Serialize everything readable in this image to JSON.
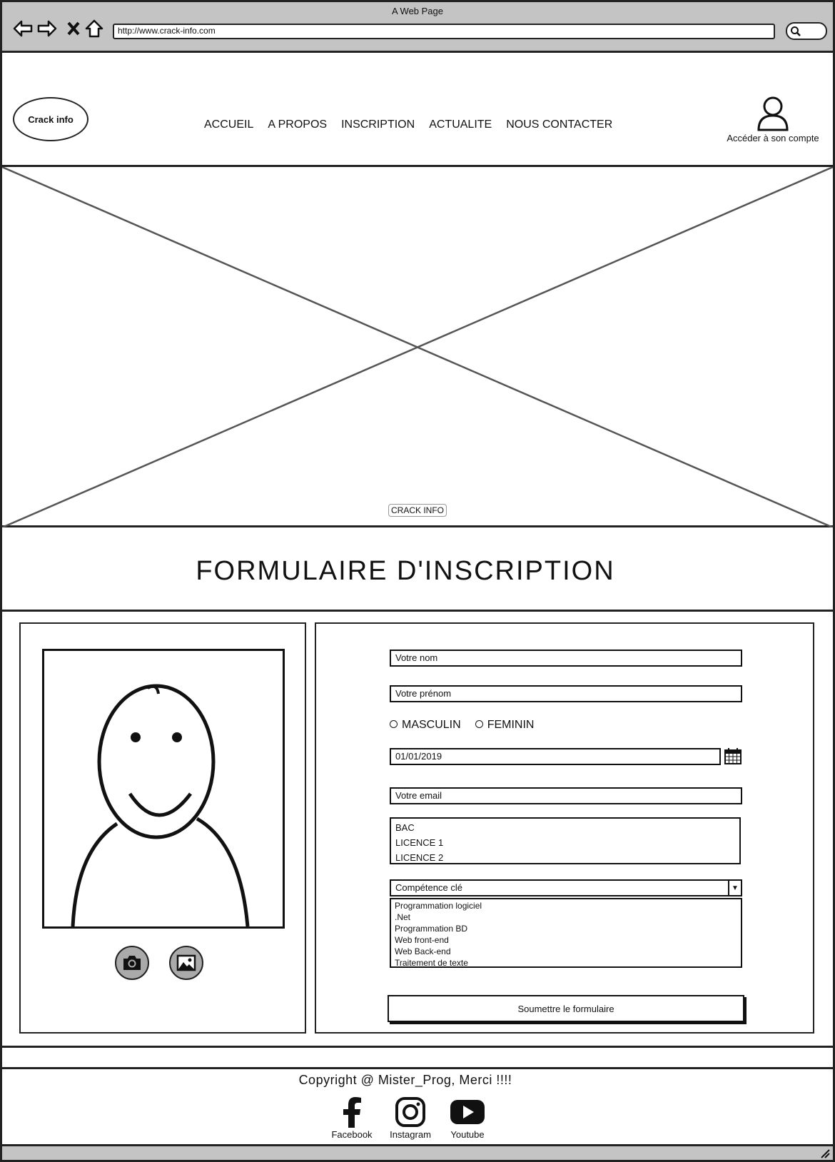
{
  "window": {
    "title": "A Web Page",
    "url": "http://www.crack-info.com"
  },
  "header": {
    "logo": "Crack info",
    "menu": [
      "ACCUEIL",
      "A PROPOS",
      "INSCRIPTION",
      "ACTUALITE",
      "NOUS CONTACTER"
    ],
    "account_label": "Accéder à son compte"
  },
  "hero": {
    "label": "CRACK INFO"
  },
  "page_title": "FORMULAIRE D'INSCRIPTION",
  "form": {
    "nom_placeholder": "Votre nom",
    "prenom_placeholder": "Votre prénom",
    "gender_options": [
      "MASCULIN",
      "FEMININ"
    ],
    "date_value": "01/01/2019",
    "email_placeholder": "Votre email",
    "diplomas": [
      "BAC",
      "LICENCE 1",
      "LICENCE 2"
    ],
    "competence_label": "Compétence clé",
    "competence_options": [
      "Programmation logiciel",
      ".Net",
      "Programmation BD",
      "Web front-end",
      "Web Back-end",
      "Traitement de texte"
    ],
    "submit_label": "Soumettre le formulaire"
  },
  "footer": {
    "copyright": "Copyright @ Mister_Prog, Merci !!!!",
    "social": [
      "Facebook",
      "Instagram",
      "Youtube"
    ]
  }
}
